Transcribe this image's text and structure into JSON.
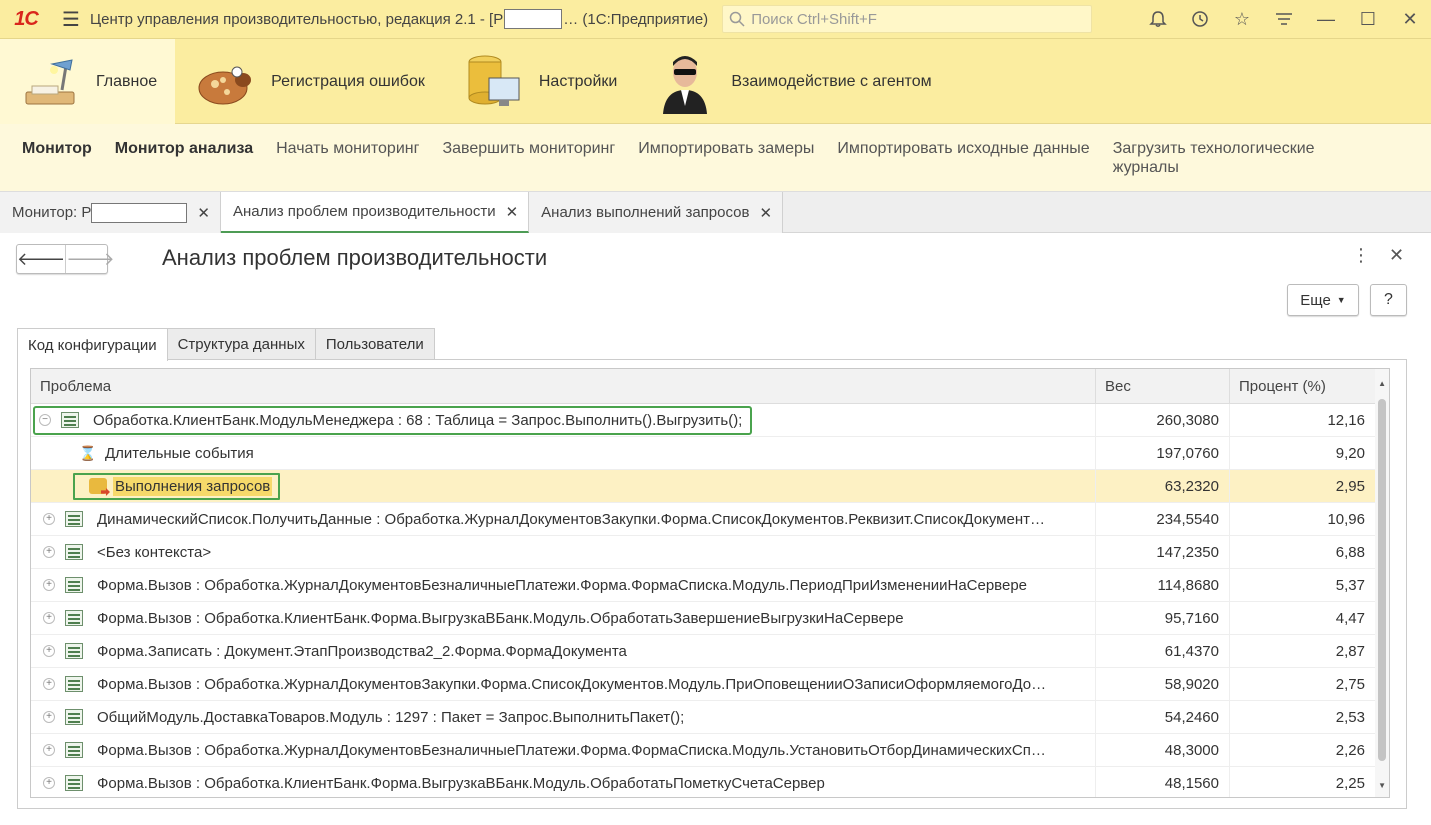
{
  "titlebar": {
    "logo": "1С",
    "title_prefix": "Центр управления производительностью, редакция 2.1 - [Р",
    "title_suffix": "…   (1С:Предприятие)",
    "search_placeholder": "Поиск Ctrl+Shift+F",
    "icons": [
      "bell-icon",
      "history-icon",
      "star-icon",
      "menu-lines-icon",
      "minimize-icon",
      "maximize-icon",
      "close-icon"
    ]
  },
  "sections": [
    {
      "label": "Главное",
      "icon": "desk-lamp-icon",
      "active": true
    },
    {
      "label": "Регистрация ошибок",
      "icon": "bug-icon",
      "active": false
    },
    {
      "label": "Настройки",
      "icon": "database-monitor-icon",
      "active": false
    },
    {
      "label": "Взаимодействие с агентом",
      "icon": "agent-icon",
      "active": false
    }
  ],
  "commands": [
    {
      "label": "Монитор",
      "bold": true
    },
    {
      "label": "Монитор анализа",
      "bold": true
    },
    {
      "label": "Начать мониторинг",
      "bold": false
    },
    {
      "label": "Завершить мониторинг",
      "bold": false
    },
    {
      "label": "Импортировать замеры",
      "bold": false
    },
    {
      "label": "Импортировать исходные данные",
      "bold": false
    },
    {
      "label": "Загрузить технологические журналы",
      "bold": false
    }
  ],
  "window_tabs": [
    {
      "label": "Монитор: Р",
      "redacted": true,
      "active": false
    },
    {
      "label": "Анализ проблем производительности",
      "redacted": false,
      "active": true
    },
    {
      "label": "Анализ выполнений запросов",
      "redacted": false,
      "active": false
    }
  ],
  "form": {
    "title": "Анализ проблем производительности",
    "more_label": "Еще",
    "help_label": "?",
    "tabs": [
      "Код конфигурации",
      "Структура данных",
      "Пользователи"
    ],
    "columns": [
      "Проблема",
      "Вес",
      "Процент (%)"
    ],
    "rows": [
      {
        "level": 0,
        "expander": "⊖",
        "icon": "module",
        "problem": "Обработка.КлиентБанк.МодульМенеджера : 68 : Таблица = Запрос.Выполнить().Выгрузить();",
        "weight": "260,3080",
        "percent": "12,16",
        "highlight": "box"
      },
      {
        "level": 1,
        "expander": "",
        "icon": "hourglass",
        "problem": "Длительные события",
        "weight": "197,0760",
        "percent": "9,20",
        "highlight": ""
      },
      {
        "level": 1,
        "expander": "",
        "icon": "db",
        "problem": "Выполнения запросов",
        "weight": "63,2320",
        "percent": "2,95",
        "highlight": "selected"
      },
      {
        "level": 0,
        "expander": "⊕",
        "icon": "module",
        "problem": "ДинамическийСписок.ПолучитьДанные : Обработка.ЖурналДокументовЗакупки.Форма.СписокДокументов.Реквизит.СписокДокумент…",
        "weight": "234,5540",
        "percent": "10,96",
        "highlight": ""
      },
      {
        "level": 0,
        "expander": "⊕",
        "icon": "module",
        "problem": "<Без контекста>",
        "weight": "147,2350",
        "percent": "6,88",
        "highlight": ""
      },
      {
        "level": 0,
        "expander": "⊕",
        "icon": "module",
        "problem": "Форма.Вызов : Обработка.ЖурналДокументовБезналичныеПлатежи.Форма.ФормаСписка.Модуль.ПериодПриИзмененииНаСервере",
        "weight": "114,8680",
        "percent": "5,37",
        "highlight": ""
      },
      {
        "level": 0,
        "expander": "⊕",
        "icon": "module",
        "problem": "Форма.Вызов : Обработка.КлиентБанк.Форма.ВыгрузкаВБанк.Модуль.ОбработатьЗавершениеВыгрузкиНаСервере",
        "weight": "95,7160",
        "percent": "4,47",
        "highlight": ""
      },
      {
        "level": 0,
        "expander": "⊕",
        "icon": "module",
        "problem": "Форма.Записать : Документ.ЭтапПроизводства2_2.Форма.ФормаДокумента",
        "weight": "61,4370",
        "percent": "2,87",
        "highlight": ""
      },
      {
        "level": 0,
        "expander": "⊕",
        "icon": "module",
        "problem": "Форма.Вызов : Обработка.ЖурналДокументовЗакупки.Форма.СписокДокументов.Модуль.ПриОповещенииОЗаписиОформляемогоДо…",
        "weight": "58,9020",
        "percent": "2,75",
        "highlight": ""
      },
      {
        "level": 0,
        "expander": "⊕",
        "icon": "module",
        "problem": "ОбщийМодуль.ДоставкаТоваров.Модуль : 1297 : Пакет = Запрос.ВыполнитьПакет();",
        "weight": "54,2460",
        "percent": "2,53",
        "highlight": ""
      },
      {
        "level": 0,
        "expander": "⊕",
        "icon": "module",
        "problem": "Форма.Вызов : Обработка.ЖурналДокументовБезналичныеПлатежи.Форма.ФормаСписка.Модуль.УстановитьОтборДинамическихСп…",
        "weight": "48,3000",
        "percent": "2,26",
        "highlight": ""
      },
      {
        "level": 0,
        "expander": "⊕",
        "icon": "module",
        "problem": "Форма.Вызов : Обработка.КлиентБанк.Форма.ВыгрузкаВБанк.Модуль.ОбработатьПометкуСчетаСервер",
        "weight": "48,1560",
        "percent": "2,25",
        "highlight": ""
      }
    ]
  },
  "colors": {
    "panel_yellow": "#fbeda0",
    "highlight_green": "#4aa34d",
    "selected_row": "#fdf1c4"
  }
}
